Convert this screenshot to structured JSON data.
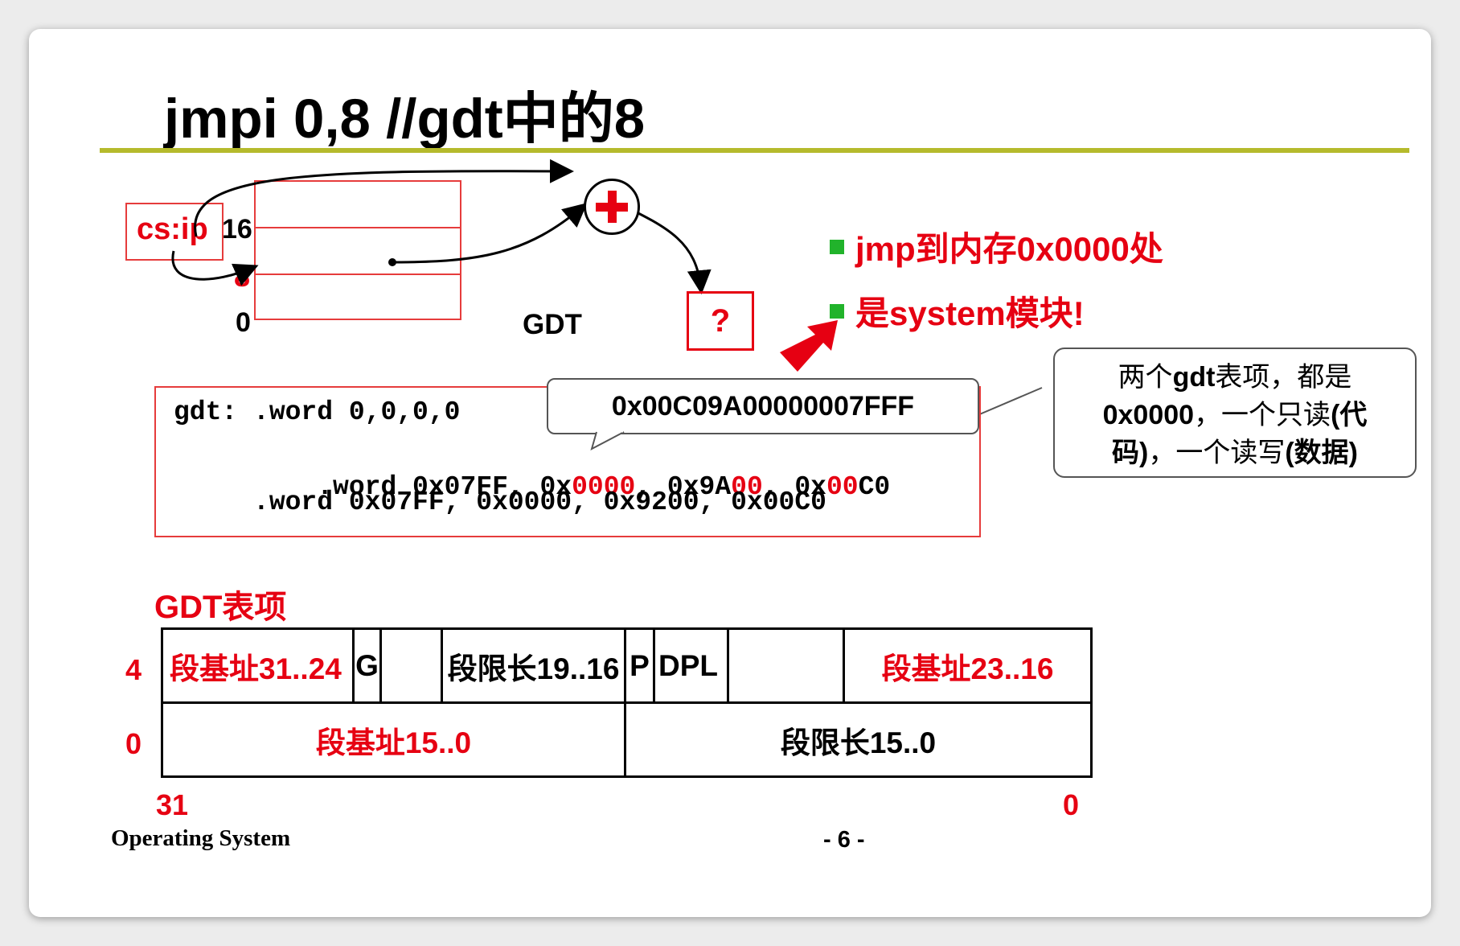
{
  "slide": {
    "title": "jmpi 0,8  //gdt中的8",
    "footer_left": "Operating System",
    "footer_page": "- 6 -"
  },
  "diagram": {
    "register_label": "cs:ip",
    "table_indices": [
      "16",
      "8",
      "0"
    ],
    "table_name": "GDT",
    "adder_symbol": "+",
    "unknown_result": "?"
  },
  "bullets": [
    "jmp到内存0x0000处",
    "是system模块!"
  ],
  "code": {
    "line1": "gdt: .word 0,0,0,0",
    "line2": {
      "indent": "     .word 0x07FF, 0x",
      "a_red": "0000",
      "b": ", 0x9A",
      "b_red": "00",
      "c": ", 0x",
      "c_red": "00",
      "d": "C0"
    },
    "line3": "     .word 0x07FF, 0x0000, 0x9200, 0x00C0"
  },
  "tooltip_value": "0x00C09A00000007FFF",
  "callout": {
    "line1_a": "两个",
    "line1_b": "gdt",
    "line1_c": "表项，都是",
    "line2_a": "0x0000",
    "line2_b": "，一个只读",
    "line2_c": "(代",
    "line3_a": "码)",
    "line3_b": "，一个读写",
    "line3_c": "(数据)"
  },
  "gdt_entry": {
    "heading": "GDT表项",
    "row_labels": [
      "4",
      "0"
    ],
    "upper_cells": [
      "段基址31..24",
      "G",
      "",
      "段限长19..16",
      "P",
      "DPL",
      "",
      "段基址23..16"
    ],
    "lower_cells": [
      "段基址15..0",
      "段限长15..0"
    ],
    "bit_left": "31",
    "bit_right": "0"
  },
  "colors": {
    "accent_red": "#e60012",
    "rule_olive": "#b5ba2c",
    "bullet_green": "#21b32b"
  }
}
